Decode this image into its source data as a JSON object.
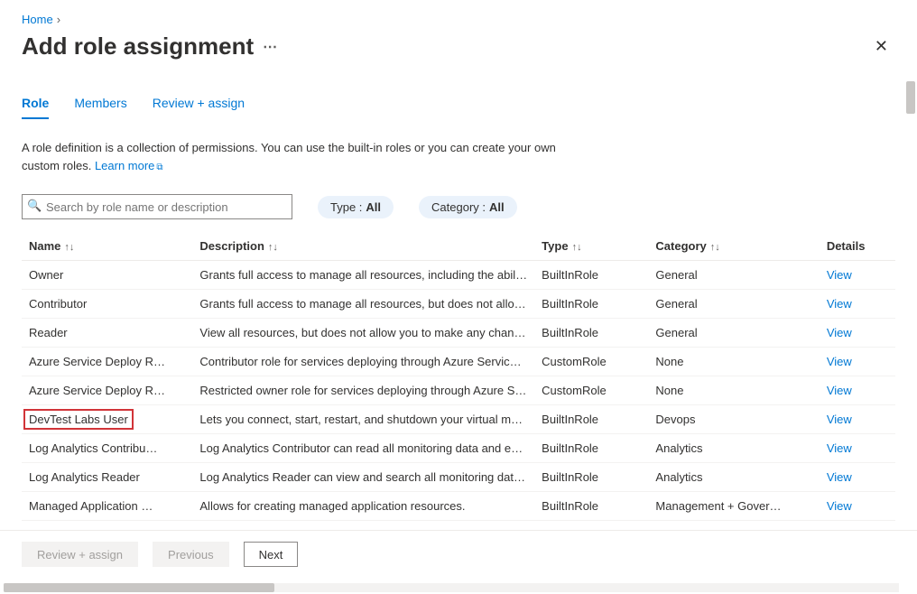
{
  "breadcrumb": {
    "home": "Home"
  },
  "header": {
    "title": "Add role assignment"
  },
  "tabs": {
    "role": "Role",
    "members": "Members",
    "review": "Review + assign",
    "active": "role"
  },
  "description": {
    "text": "A role definition is a collection of permissions. You can use the built-in roles or you can create your own custom roles.",
    "learn_more": "Learn more"
  },
  "search": {
    "placeholder": "Search by role name or description"
  },
  "filters": {
    "type_label": "Type :",
    "type_value": "All",
    "category_label": "Category :",
    "category_value": "All"
  },
  "columns": {
    "name": "Name",
    "description": "Description",
    "type": "Type",
    "category": "Category",
    "details": "Details"
  },
  "rows": [
    {
      "name": "Owner",
      "description": "Grants full access to manage all resources, including the abili…",
      "type": "BuiltInRole",
      "category": "General",
      "details": "View",
      "highlight": false
    },
    {
      "name": "Contributor",
      "description": "Grants full access to manage all resources, but does not allo…",
      "type": "BuiltInRole",
      "category": "General",
      "details": "View",
      "highlight": false
    },
    {
      "name": "Reader",
      "description": "View all resources, but does not allow you to make any chan…",
      "type": "BuiltInRole",
      "category": "General",
      "details": "View",
      "highlight": false
    },
    {
      "name": "Azure Service Deploy R…",
      "description": "Contributor role for services deploying through Azure Servic…",
      "type": "CustomRole",
      "category": "None",
      "details": "View",
      "highlight": false
    },
    {
      "name": "Azure Service Deploy R…",
      "description": "Restricted owner role for services deploying through Azure S…",
      "type": "CustomRole",
      "category": "None",
      "details": "View",
      "highlight": false
    },
    {
      "name": "DevTest Labs User",
      "description": "Lets you connect, start, restart, and shutdown your virtual m…",
      "type": "BuiltInRole",
      "category": "Devops",
      "details": "View",
      "highlight": true
    },
    {
      "name": "Log Analytics Contribu…",
      "description": "Log Analytics Contributor can read all monitoring data and e…",
      "type": "BuiltInRole",
      "category": "Analytics",
      "details": "View",
      "highlight": false
    },
    {
      "name": "Log Analytics Reader",
      "description": "Log Analytics Reader can view and search all monitoring dat…",
      "type": "BuiltInRole",
      "category": "Analytics",
      "details": "View",
      "highlight": false
    },
    {
      "name": "Managed Application …",
      "description": "Allows for creating managed application resources.",
      "type": "BuiltInRole",
      "category": "Management + Gover…",
      "details": "View",
      "highlight": false
    }
  ],
  "footer": {
    "review": "Review + assign",
    "previous": "Previous",
    "next": "Next"
  }
}
